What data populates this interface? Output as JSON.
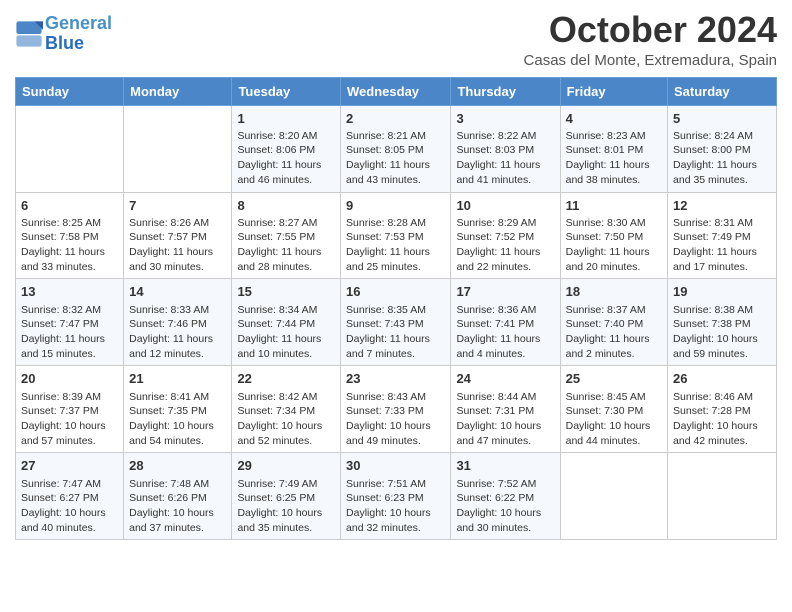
{
  "logo": {
    "line1": "General",
    "line2": "Blue"
  },
  "title": "October 2024",
  "subtitle": "Casas del Monte, Extremadura, Spain",
  "header_days": [
    "Sunday",
    "Monday",
    "Tuesday",
    "Wednesday",
    "Thursday",
    "Friday",
    "Saturday"
  ],
  "weeks": [
    [
      {
        "day": "",
        "content": ""
      },
      {
        "day": "",
        "content": ""
      },
      {
        "day": "1",
        "content": "Sunrise: 8:20 AM\nSunset: 8:06 PM\nDaylight: 11 hours and 46 minutes."
      },
      {
        "day": "2",
        "content": "Sunrise: 8:21 AM\nSunset: 8:05 PM\nDaylight: 11 hours and 43 minutes."
      },
      {
        "day": "3",
        "content": "Sunrise: 8:22 AM\nSunset: 8:03 PM\nDaylight: 11 hours and 41 minutes."
      },
      {
        "day": "4",
        "content": "Sunrise: 8:23 AM\nSunset: 8:01 PM\nDaylight: 11 hours and 38 minutes."
      },
      {
        "day": "5",
        "content": "Sunrise: 8:24 AM\nSunset: 8:00 PM\nDaylight: 11 hours and 35 minutes."
      }
    ],
    [
      {
        "day": "6",
        "content": "Sunrise: 8:25 AM\nSunset: 7:58 PM\nDaylight: 11 hours and 33 minutes."
      },
      {
        "day": "7",
        "content": "Sunrise: 8:26 AM\nSunset: 7:57 PM\nDaylight: 11 hours and 30 minutes."
      },
      {
        "day": "8",
        "content": "Sunrise: 8:27 AM\nSunset: 7:55 PM\nDaylight: 11 hours and 28 minutes."
      },
      {
        "day": "9",
        "content": "Sunrise: 8:28 AM\nSunset: 7:53 PM\nDaylight: 11 hours and 25 minutes."
      },
      {
        "day": "10",
        "content": "Sunrise: 8:29 AM\nSunset: 7:52 PM\nDaylight: 11 hours and 22 minutes."
      },
      {
        "day": "11",
        "content": "Sunrise: 8:30 AM\nSunset: 7:50 PM\nDaylight: 11 hours and 20 minutes."
      },
      {
        "day": "12",
        "content": "Sunrise: 8:31 AM\nSunset: 7:49 PM\nDaylight: 11 hours and 17 minutes."
      }
    ],
    [
      {
        "day": "13",
        "content": "Sunrise: 8:32 AM\nSunset: 7:47 PM\nDaylight: 11 hours and 15 minutes."
      },
      {
        "day": "14",
        "content": "Sunrise: 8:33 AM\nSunset: 7:46 PM\nDaylight: 11 hours and 12 minutes."
      },
      {
        "day": "15",
        "content": "Sunrise: 8:34 AM\nSunset: 7:44 PM\nDaylight: 11 hours and 10 minutes."
      },
      {
        "day": "16",
        "content": "Sunrise: 8:35 AM\nSunset: 7:43 PM\nDaylight: 11 hours and 7 minutes."
      },
      {
        "day": "17",
        "content": "Sunrise: 8:36 AM\nSunset: 7:41 PM\nDaylight: 11 hours and 4 minutes."
      },
      {
        "day": "18",
        "content": "Sunrise: 8:37 AM\nSunset: 7:40 PM\nDaylight: 11 hours and 2 minutes."
      },
      {
        "day": "19",
        "content": "Sunrise: 8:38 AM\nSunset: 7:38 PM\nDaylight: 10 hours and 59 minutes."
      }
    ],
    [
      {
        "day": "20",
        "content": "Sunrise: 8:39 AM\nSunset: 7:37 PM\nDaylight: 10 hours and 57 minutes."
      },
      {
        "day": "21",
        "content": "Sunrise: 8:41 AM\nSunset: 7:35 PM\nDaylight: 10 hours and 54 minutes."
      },
      {
        "day": "22",
        "content": "Sunrise: 8:42 AM\nSunset: 7:34 PM\nDaylight: 10 hours and 52 minutes."
      },
      {
        "day": "23",
        "content": "Sunrise: 8:43 AM\nSunset: 7:33 PM\nDaylight: 10 hours and 49 minutes."
      },
      {
        "day": "24",
        "content": "Sunrise: 8:44 AM\nSunset: 7:31 PM\nDaylight: 10 hours and 47 minutes."
      },
      {
        "day": "25",
        "content": "Sunrise: 8:45 AM\nSunset: 7:30 PM\nDaylight: 10 hours and 44 minutes."
      },
      {
        "day": "26",
        "content": "Sunrise: 8:46 AM\nSunset: 7:28 PM\nDaylight: 10 hours and 42 minutes."
      }
    ],
    [
      {
        "day": "27",
        "content": "Sunrise: 7:47 AM\nSunset: 6:27 PM\nDaylight: 10 hours and 40 minutes."
      },
      {
        "day": "28",
        "content": "Sunrise: 7:48 AM\nSunset: 6:26 PM\nDaylight: 10 hours and 37 minutes."
      },
      {
        "day": "29",
        "content": "Sunrise: 7:49 AM\nSunset: 6:25 PM\nDaylight: 10 hours and 35 minutes."
      },
      {
        "day": "30",
        "content": "Sunrise: 7:51 AM\nSunset: 6:23 PM\nDaylight: 10 hours and 32 minutes."
      },
      {
        "day": "31",
        "content": "Sunrise: 7:52 AM\nSunset: 6:22 PM\nDaylight: 10 hours and 30 minutes."
      },
      {
        "day": "",
        "content": ""
      },
      {
        "day": "",
        "content": ""
      }
    ]
  ]
}
